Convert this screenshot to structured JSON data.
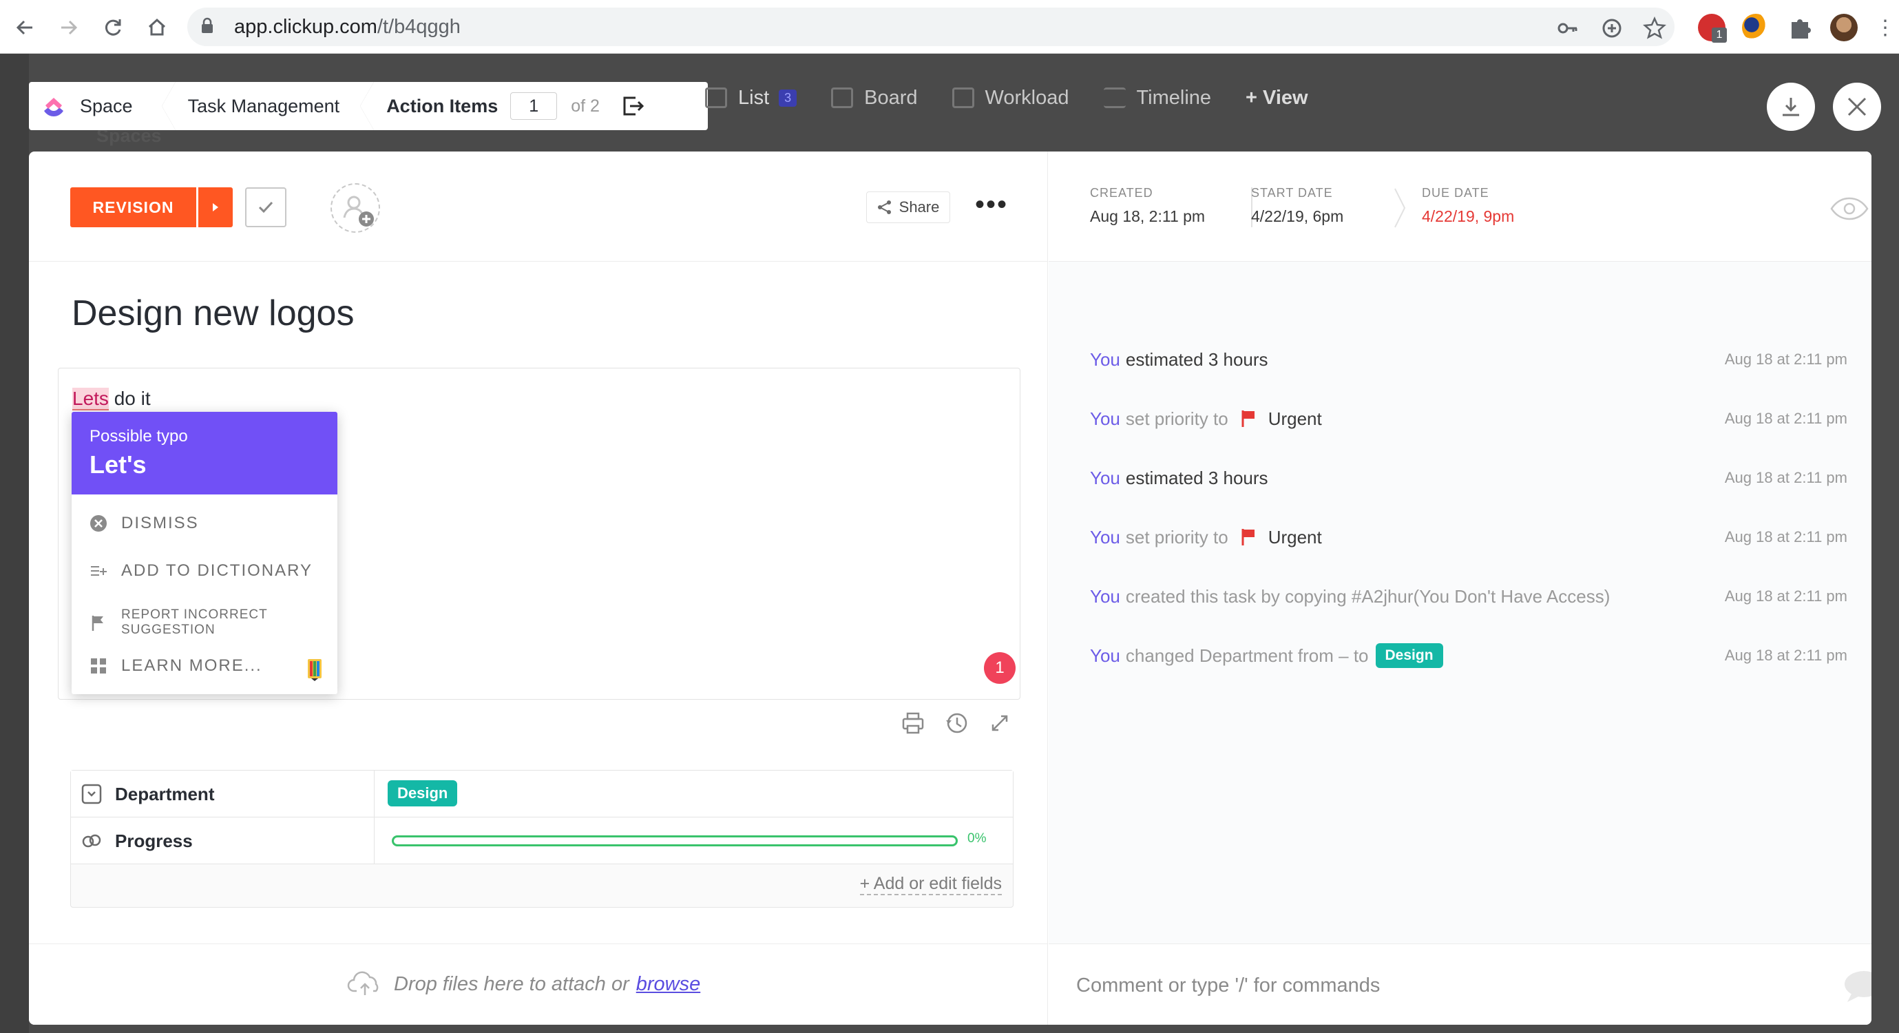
{
  "browser": {
    "url_host": "app.clickup.com",
    "url_path": "/t/b4qggh",
    "ext_badge": "1"
  },
  "breadcrumb": {
    "space": "Space",
    "folder": "Task Management",
    "list": "Action Items",
    "page_current": "1",
    "page_total": "of 2"
  },
  "sidebar_peek": {
    "label": "Spaces"
  },
  "view_tabs": [
    {
      "label": "List",
      "badge": "3"
    },
    {
      "label": "Board"
    },
    {
      "label": "Workload"
    },
    {
      "label": "Timeline"
    },
    {
      "label": "+ View"
    }
  ],
  "task": {
    "status": "REVISION",
    "share_label": "Share",
    "title": "Design new logos",
    "description_typo": "Lets",
    "description_rest": " do it",
    "notification_count": "1"
  },
  "dates": {
    "created_label": "CREATED",
    "created_value": "Aug 18, 2:11 pm",
    "start_label": "START DATE",
    "start_value": "4/22/19, 6pm",
    "due_label": "DUE DATE",
    "due_value": "4/22/19, 9pm"
  },
  "typo_popup": {
    "kind": "Possible typo",
    "suggestion": "Let's",
    "dismiss": "DISMISS",
    "add_to_dictionary": "ADD TO DICTIONARY",
    "report_line1": "REPORT INCORRECT",
    "report_line2": "SUGGESTION",
    "learn_more": "LEARN MORE..."
  },
  "fields": {
    "department_label": "Department",
    "department_value": "Design",
    "progress_label": "Progress",
    "progress_value": 0,
    "progress_text": "0%",
    "add_fields": "+ Add or edit fields"
  },
  "activity": [
    {
      "actor": "You",
      "action": "estimated 3 hours",
      "style": "dark",
      "time": "Aug 18 at 2:11 pm"
    },
    {
      "actor": "You",
      "action": "set priority to",
      "flag": true,
      "value": "Urgent",
      "style": "light",
      "time": "Aug 18 at 2:11 pm"
    },
    {
      "actor": "You",
      "action": "estimated 3 hours",
      "style": "dark",
      "time": "Aug 18 at 2:11 pm"
    },
    {
      "actor": "You",
      "action": "set priority to",
      "flag": true,
      "value": "Urgent",
      "style": "light",
      "time": "Aug 18 at 2:11 pm"
    },
    {
      "actor": "You",
      "action": "created this task by copying #A2jhur(You Don't Have Access)",
      "style": "light",
      "time": "Aug 18 at 2:11 pm"
    },
    {
      "actor": "You",
      "action": "changed Department from – to",
      "tag": "Design",
      "style": "light",
      "time": "Aug 18 at 2:11 pm"
    }
  ],
  "footer": {
    "drop_text": "Drop files here to attach or",
    "browse": "browse",
    "comment_placeholder": "Comment or type '/' for commands"
  },
  "colors": {
    "status": "#ff5722",
    "accent": "#7150f6",
    "tag": "#14b8a6",
    "urgent": "#e53935",
    "progress": "#39c36c"
  }
}
